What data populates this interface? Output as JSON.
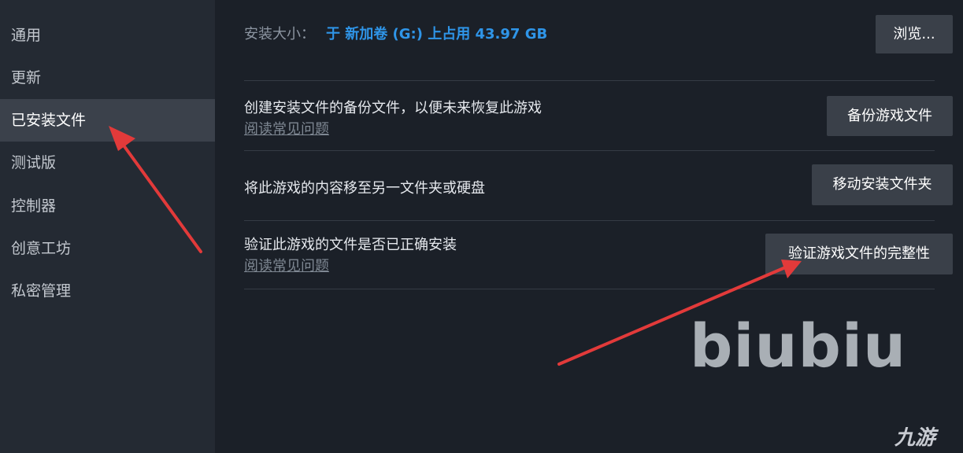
{
  "sidebar": {
    "items": [
      {
        "label": "通用"
      },
      {
        "label": "更新"
      },
      {
        "label": "已安装文件",
        "active": true
      },
      {
        "label": "测试版"
      },
      {
        "label": "控制器"
      },
      {
        "label": "创意工坊"
      },
      {
        "label": "私密管理"
      }
    ]
  },
  "main": {
    "install_size": {
      "label": "安装大小：",
      "value": "于 新加卷 (G:) 上占用 43.97 GB",
      "browse_button": "浏览..."
    },
    "rows": [
      {
        "text": "创建安装文件的备份文件，以便未来恢复此游戏",
        "link": "阅读常见问题",
        "button": "备份游戏文件"
      },
      {
        "text": "将此游戏的内容移至另一文件夹或硬盘",
        "button": "移动安装文件夹"
      },
      {
        "text": "验证此游戏的文件是否已正确安装",
        "link": "阅读常见问题",
        "button": "验证游戏文件的完整性"
      }
    ]
  },
  "watermark": "biubiu",
  "logo": "九游",
  "colors": {
    "sidebar_bg": "#242a33",
    "sidebar_active_bg": "#3b414b",
    "main_bg": "#1b2028",
    "button_bg": "#3a4049",
    "accent_blue": "#2f95e8",
    "annotation_red": "#e23a3a"
  }
}
